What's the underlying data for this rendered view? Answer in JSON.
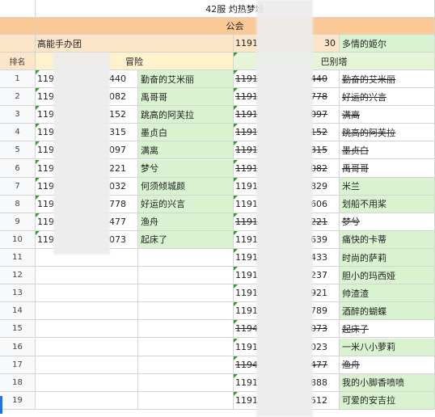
{
  "title": "42服 灼热梦境",
  "guild_header": "公会",
  "guild_left": "高能手办团",
  "guild_right_id_start": "1191",
  "guild_right_id_end": "30",
  "guild_right_name": "多情的姬尔",
  "col_rank": "排名",
  "col_left": "冒险",
  "col_right": "巴别塔",
  "rows": [
    {
      "rank": "1",
      "lid_a": "119",
      "lid_b": "440",
      "lname": "勤奋的艾米丽",
      "rid_a": "1191",
      "rid_b": "440",
      "rname": "勤奋的艾米丽",
      "rstrike": true
    },
    {
      "rank": "2",
      "lid_a": "119",
      "lid_b": "082",
      "lname": "禹哥哥",
      "rid_a": "1191",
      "rid_b": "778",
      "rname": "好运的兴言",
      "rstrike": true
    },
    {
      "rank": "3",
      "lid_a": "119",
      "lid_b": "152",
      "lname": "跳高的阿芙拉",
      "rid_a": "1191",
      "rid_b": "097",
      "rname": "满离",
      "rstrike": true
    },
    {
      "rank": "4",
      "lid_a": "119",
      "lid_b": "315",
      "lname": "墨贞白",
      "rid_a": "1191",
      "rid_b": "152",
      "rname": "跳高的阿芙拉",
      "rstrike": true
    },
    {
      "rank": "5",
      "lid_a": "119",
      "lid_b": "097",
      "lname": "满离",
      "rid_a": "1191",
      "rid_b": "315",
      "rname": "墨贞白",
      "rstrike": true
    },
    {
      "rank": "6",
      "lid_a": "119",
      "lid_b": "221",
      "lname": "梦兮",
      "rid_a": "1191",
      "rid_b": "082",
      "rname": "禹哥哥",
      "rstrike": true
    },
    {
      "rank": "7",
      "lid_a": "119",
      "lid_b": "032",
      "lname": "何须倾城颜",
      "rid_a": "1191",
      "rid_b": "829",
      "rname": "米兰",
      "rstrike": false
    },
    {
      "rank": "8",
      "lid_a": "119",
      "lid_b": "778",
      "lname": "好运的兴言",
      "rid_a": "1191",
      "rid_b": "606",
      "rname": "划船不用桨",
      "rstrike": false
    },
    {
      "rank": "9",
      "lid_a": "119",
      "lid_b": "477",
      "lname": "渔舟",
      "rid_a": "1191",
      "rid_b": "221",
      "rname": "梦兮",
      "rstrike": true
    },
    {
      "rank": "10",
      "lid_a": "119",
      "lid_b": "073",
      "lname": "起床了",
      "rid_a": "1191",
      "rid_b": "639",
      "rname": "痛快的卡蒂",
      "rstrike": false
    },
    {
      "rank": "11",
      "lid_a": "",
      "lid_b": "",
      "lname": "",
      "rid_a": "1191",
      "rid_b": "433",
      "rname": "时尚的萨莉",
      "rstrike": false
    },
    {
      "rank": "12",
      "lid_a": "",
      "lid_b": "",
      "lname": "",
      "rid_a": "1191",
      "rid_b": "237",
      "rname": "胆小的玛西娅",
      "rstrike": false
    },
    {
      "rank": "13",
      "lid_a": "",
      "lid_b": "",
      "lname": "",
      "rid_a": "1191",
      "rid_b": "921",
      "rname": "帅渣渣",
      "rstrike": false
    },
    {
      "rank": "14",
      "lid_a": "",
      "lid_b": "",
      "lname": "",
      "rid_a": "1191",
      "rid_b": "789",
      "rname": "酒醉的蝴蝶",
      "rstrike": false
    },
    {
      "rank": "15",
      "lid_a": "",
      "lid_b": "",
      "lname": "",
      "rid_a": "1194",
      "rid_b": "073",
      "rname": "起床子",
      "rstrike": true
    },
    {
      "rank": "16",
      "lid_a": "",
      "lid_b": "",
      "lname": "",
      "rid_a": "1191",
      "rid_b": "023",
      "rname": "一米八小萝莉",
      "rstrike": false
    },
    {
      "rank": "17",
      "lid_a": "",
      "lid_b": "",
      "lname": "",
      "rid_a": "1194",
      "rid_b": "477",
      "rname": "渔舟",
      "rstrike": true
    },
    {
      "rank": "18",
      "lid_a": "",
      "lid_b": "",
      "lname": "",
      "rid_a": "1191",
      "rid_b": "888",
      "rname": "我的小脚香喷喷",
      "rstrike": false
    },
    {
      "rank": "19",
      "lid_a": "",
      "lid_b": "",
      "lname": "",
      "rid_a": "1191",
      "rid_b": "512",
      "rname": "可爱的安吉拉",
      "rstrike": false
    }
  ]
}
